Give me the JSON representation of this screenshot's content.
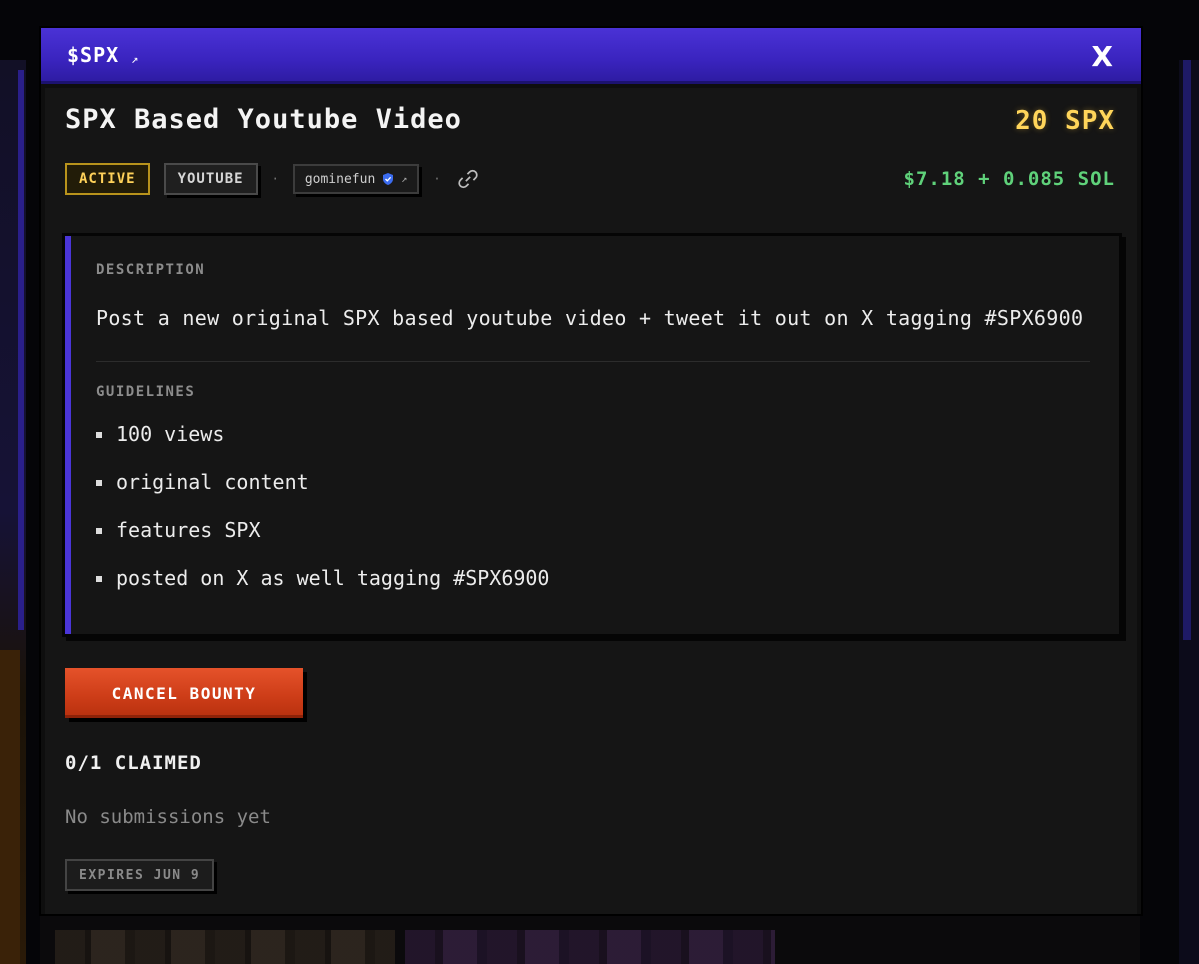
{
  "window": {
    "ticker": "$SPX",
    "ticker_arrow": "↗",
    "close_label": "X"
  },
  "bounty": {
    "title": "SPX Based Youtube Video",
    "reward": "20 SPX",
    "usd_value": "$7.18 + 0.085 SOL",
    "status": "ACTIVE",
    "platform": "YOUTUBE",
    "separator": "·",
    "creator": "gominefun",
    "creator_arrow": "↗"
  },
  "description": {
    "label": "DESCRIPTION",
    "text": "Post a new original SPX based youtube video + tweet it out on X tagging #SPX6900"
  },
  "guidelines": {
    "label": "GUIDELINES",
    "items": [
      "100 views",
      "original content",
      "features SPX",
      "posted on X as well tagging #SPX6900"
    ]
  },
  "actions": {
    "cancel_label": "CANCEL BOUNTY"
  },
  "claims": {
    "summary": "0/1 CLAIMED",
    "empty_text": "No submissions yet"
  },
  "expiry": {
    "label": "EXPIRES JUN 9"
  },
  "icons": {
    "verified": "verified-badge-icon",
    "link": "link-icon",
    "close": "close-icon"
  },
  "colors": {
    "titlebar": "#3a24bf",
    "accent": "#4a35d8",
    "reward": "#ffd55a",
    "usd": "#5fd17a",
    "status": "#ffd25a",
    "danger": "#d9461f"
  }
}
